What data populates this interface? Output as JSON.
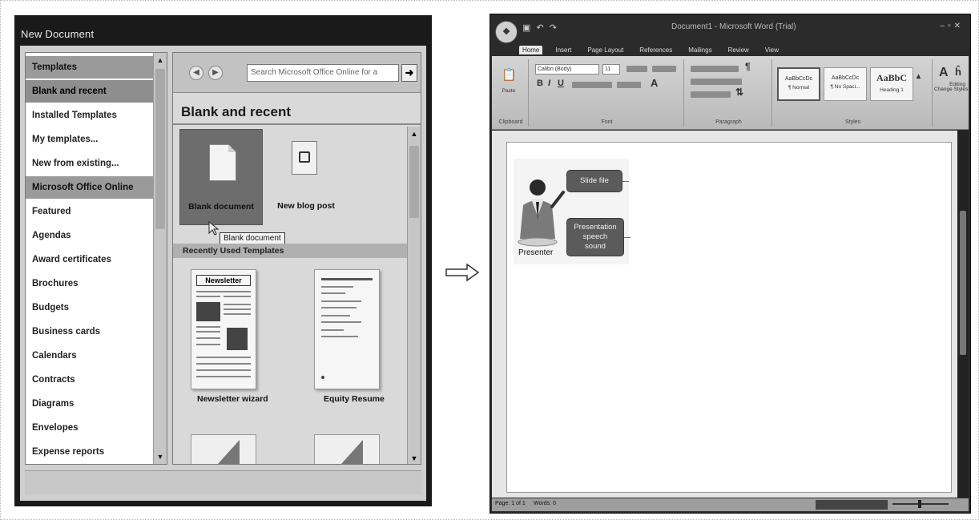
{
  "dialog": {
    "title": "New Document",
    "templates_pane": {
      "items": [
        {
          "label": "Templates",
          "kind": "header"
        },
        {
          "label": "Blank and recent",
          "kind": "selected"
        },
        {
          "label": "Installed Templates",
          "kind": "item"
        },
        {
          "label": "My templates...",
          "kind": "item"
        },
        {
          "label": "New from existing...",
          "kind": "item"
        },
        {
          "label": "Microsoft Office Online",
          "kind": "header"
        },
        {
          "label": "Featured",
          "kind": "item"
        },
        {
          "label": "Agendas",
          "kind": "item"
        },
        {
          "label": "Award certificates",
          "kind": "item"
        },
        {
          "label": "Brochures",
          "kind": "item"
        },
        {
          "label": "Budgets",
          "kind": "item"
        },
        {
          "label": "Business cards",
          "kind": "item"
        },
        {
          "label": "Calendars",
          "kind": "item"
        },
        {
          "label": "Contracts",
          "kind": "item"
        },
        {
          "label": "Diagrams",
          "kind": "item"
        },
        {
          "label": "Envelopes",
          "kind": "item"
        },
        {
          "label": "Expense reports",
          "kind": "item"
        }
      ]
    },
    "search": {
      "placeholder": "Search Microsoft Office Online for a"
    },
    "section_heading": "Blank and recent",
    "blank_card_label": "Blank document",
    "blog_card_label": "New blog post",
    "tooltip": "Blank document",
    "recent_heading": "Recently Used Templates",
    "newsletter_thumb_title": "Newsletter",
    "recent_templates": [
      {
        "label": "Newsletter wizard"
      },
      {
        "label": "Equity Resume"
      }
    ]
  },
  "word": {
    "title": "Document1 - Microsoft Word (Trial)",
    "tabs": [
      "Home",
      "Insert",
      "Page Layout",
      "References",
      "Mailings",
      "Review",
      "View"
    ],
    "active_tab": "Home",
    "ribbon": {
      "paste_label": "Paste",
      "font_name": "Calibri (Body)",
      "font_size": "11",
      "styles": [
        {
          "sample": "AaBbCcDc",
          "name": "¶ Normal"
        },
        {
          "sample": "AaBbCcDc",
          "name": "¶ No Spaci..."
        },
        {
          "sample": "AaBbC",
          "name": "Heading 1"
        }
      ],
      "change_styles_label": "Change Styles",
      "editing_label": "Editing",
      "group_labels": [
        "Clipboard",
        "Font",
        "Paragraph",
        "Styles"
      ]
    },
    "document": {
      "callout_slide": "Slide file",
      "callout_speech": [
        "Presentation",
        "speech",
        "sound"
      ],
      "presenter_label": "Presenter"
    },
    "status_bar": {
      "page": "Page: 1 of 1",
      "words": "Words: 0"
    }
  },
  "colors": {
    "dialog_frame": "#1a1a1a",
    "callout_fill": "#5b5b5b",
    "page": "#ffffff"
  }
}
